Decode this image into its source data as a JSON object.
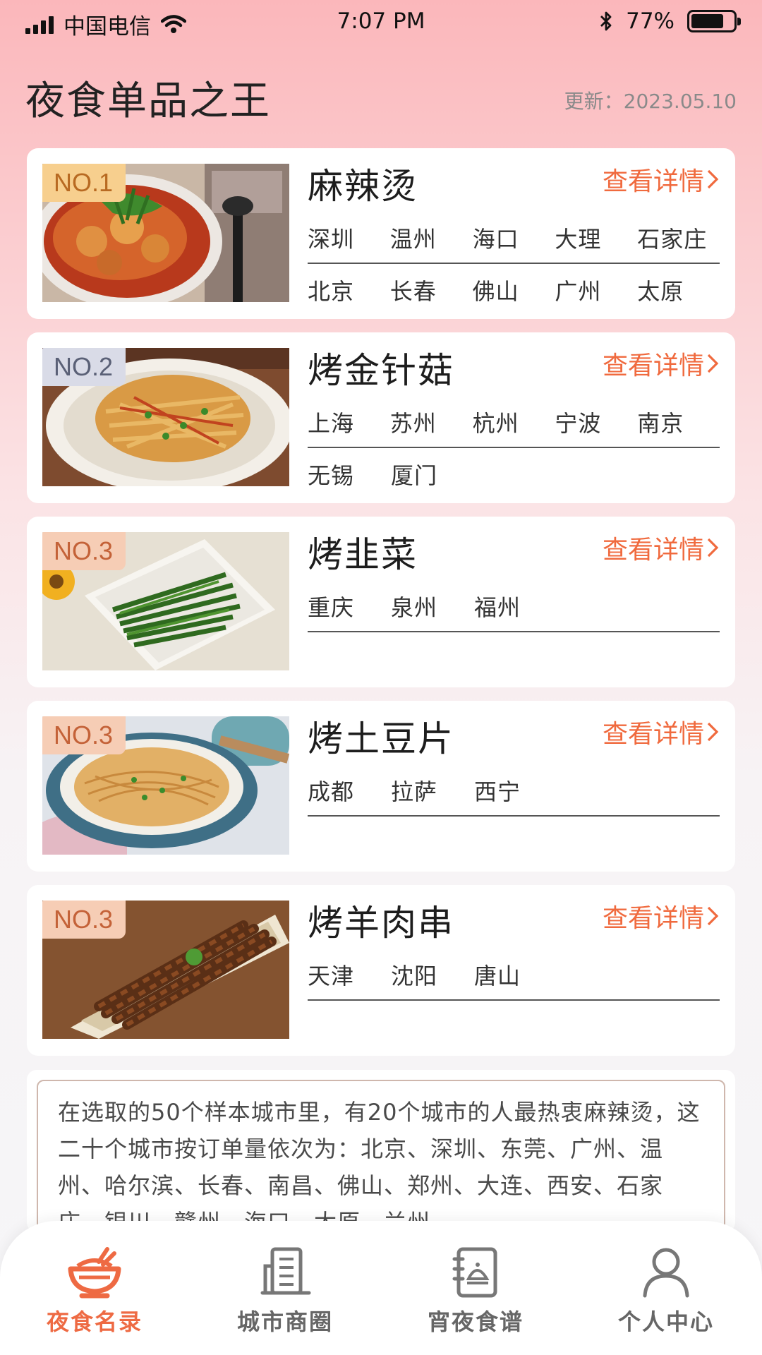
{
  "status_bar": {
    "carrier": "中国电信",
    "time": "7:07 PM",
    "battery_percent": "77%",
    "battery_level": 0.77
  },
  "header": {
    "title": "夜食单品之王",
    "update": "更新：2023.05.10"
  },
  "cards": [
    {
      "rank": "NO.1",
      "name": "麻辣烫",
      "detail": "查看详情",
      "city_rows": [
        [
          "深圳",
          "温州",
          "海口",
          "大理",
          "石家庄"
        ],
        [
          "北京",
          "长春",
          "佛山",
          "广州",
          "太原"
        ]
      ]
    },
    {
      "rank": "NO.2",
      "name": "烤金针菇",
      "detail": "查看详情",
      "city_rows": [
        [
          "上海",
          "苏州",
          "杭州",
          "宁波",
          "南京"
        ],
        [
          "无锡",
          "厦门"
        ]
      ]
    },
    {
      "rank": "NO.3",
      "name": "烤韭菜",
      "detail": "查看详情",
      "city_rows": [
        [
          "重庆",
          "泉州",
          "福州"
        ]
      ]
    },
    {
      "rank": "NO.3",
      "name": "烤土豆片",
      "detail": "查看详情",
      "city_rows": [
        [
          "成都",
          "拉萨",
          "西宁"
        ]
      ]
    },
    {
      "rank": "NO.3",
      "name": "烤羊肉串",
      "detail": "查看详情",
      "city_rows": [
        [
          "天津",
          "沈阳",
          "唐山"
        ]
      ]
    }
  ],
  "description": "在选取的50个样本城市里，有20个城市的人最热衷麻辣烫，这二十个城市按订单量依次为：北京、深圳、东莞、广州、温州、哈尔滨、长春、南昌、佛山、郑州、大连、西安、石家庄、银川、赣州、海口、太原、兰州",
  "tabs": [
    {
      "label": "夜食名录",
      "icon": "bowl-icon",
      "active": true
    },
    {
      "label": "城市商圈",
      "icon": "building-icon",
      "active": false
    },
    {
      "label": "宵夜食谱",
      "icon": "recipe-book-icon",
      "active": false
    },
    {
      "label": "个人中心",
      "icon": "person-icon",
      "active": false
    }
  ],
  "colors": {
    "accent": "#f06a3e",
    "active_tab": "#ee6a43",
    "background_top": "#fbb7bb"
  }
}
